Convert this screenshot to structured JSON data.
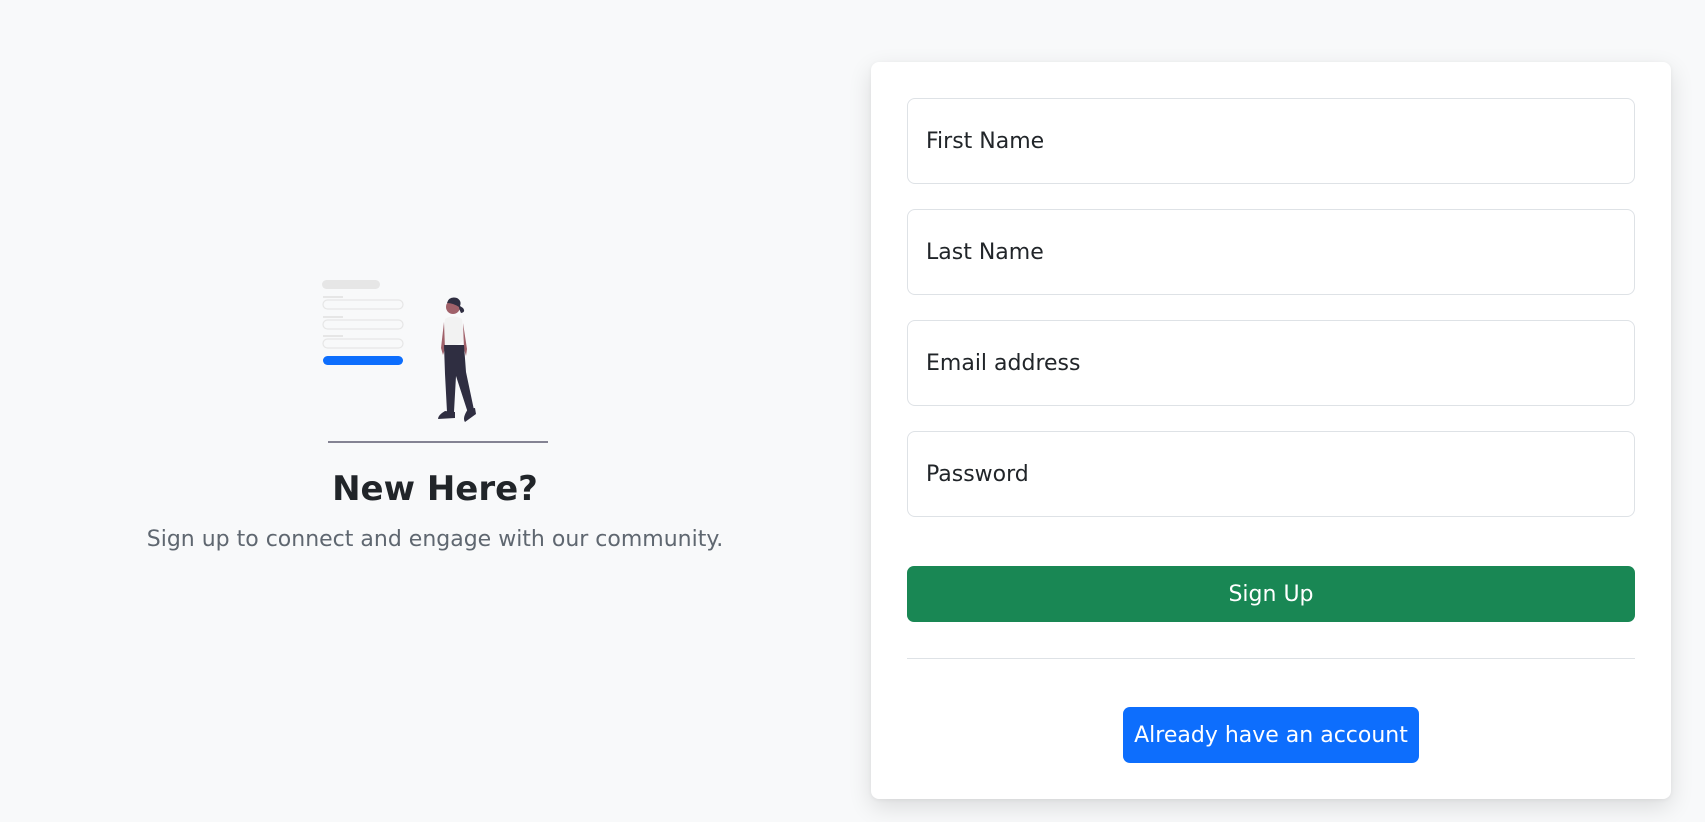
{
  "hero": {
    "title": "New Here?",
    "subtitle": "Sign up to connect and engage with our community.",
    "illustration_icon": "person-walking-by-form-illustration"
  },
  "form": {
    "first_name_placeholder": "First Name",
    "last_name_placeholder": "Last Name",
    "email_placeholder": "Email address",
    "password_placeholder": "Password",
    "signup_label": "Sign Up",
    "login_label": "Already have an account"
  },
  "colors": {
    "background": "#f8f9fa",
    "success": "#198754",
    "primary": "#0d6efd",
    "text": "#212529",
    "muted": "#5f6770"
  }
}
